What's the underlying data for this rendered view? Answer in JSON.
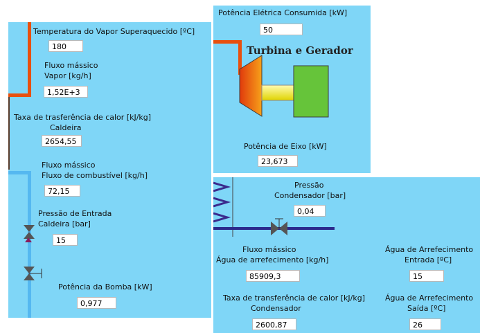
{
  "left_panel": {
    "temp_vapor_label": "Temperatura do Vapor Superaquecido [ºC]",
    "temp_vapor_value": "180",
    "fluxo_vapor_label1": "Fluxo mássico",
    "fluxo_vapor_label2": "Vapor [kg/h]",
    "fluxo_vapor_value": "1,52E+3",
    "taxa_caldeira_label1": "Taxa de trasferência de calor [kJ/kg]",
    "taxa_caldeira_label2": "Caldeira",
    "taxa_caldeira_value": "2654,55",
    "fluxo_comb_label1": "Fluxo mássico",
    "fluxo_comb_label2": "Fluxo de combustível [kg/h]",
    "fluxo_comb_value": "72,15",
    "pressao_entrada_label1": "Pressão de Entrada",
    "pressao_entrada_label2": "Caldeira [bar]",
    "pressao_entrada_value": "15",
    "potencia_bomba_label": "Potência da Bomba [kW]",
    "potencia_bomba_value": "0,977"
  },
  "turbine_panel": {
    "potencia_eletrica_label": "Potência Elétrica Consumida [kW]",
    "potencia_eletrica_value": "50",
    "title": "Turbina e Gerador",
    "potencia_eixo_label": "Potência de Eixo [kW]",
    "potencia_eixo_value": "23,673"
  },
  "condenser_panel": {
    "pressao_label1": "Pressão",
    "pressao_label2": "Condensador [bar]",
    "pressao_value": "0,04",
    "fluxo_agua_label1": "Fluxo mássico",
    "fluxo_agua_label2": "Água de arrefecimento [kg/h]",
    "fluxo_agua_value": "85909,3",
    "agua_entrada_label1": "Água de Arrefecimento",
    "agua_entrada_label2": "Entrada [ºC]",
    "agua_entrada_value": "15",
    "taxa_cond_label1": "Taxa de transferência de calor [kJ/kg]",
    "taxa_cond_label2": "Condensador",
    "taxa_cond_value": "2600,87",
    "agua_saida_label1": "Água de Arrefecimento",
    "agua_saida_label2": "Saída [ºC]",
    "agua_saida_value": "26"
  },
  "colors": {
    "panel_bg": "#7fd6f7",
    "steam_pipe": "#e8500e",
    "water_pipe": "#55b8f0",
    "cooling_pipe": "#2b2a8c",
    "generator": "#66c43a"
  }
}
